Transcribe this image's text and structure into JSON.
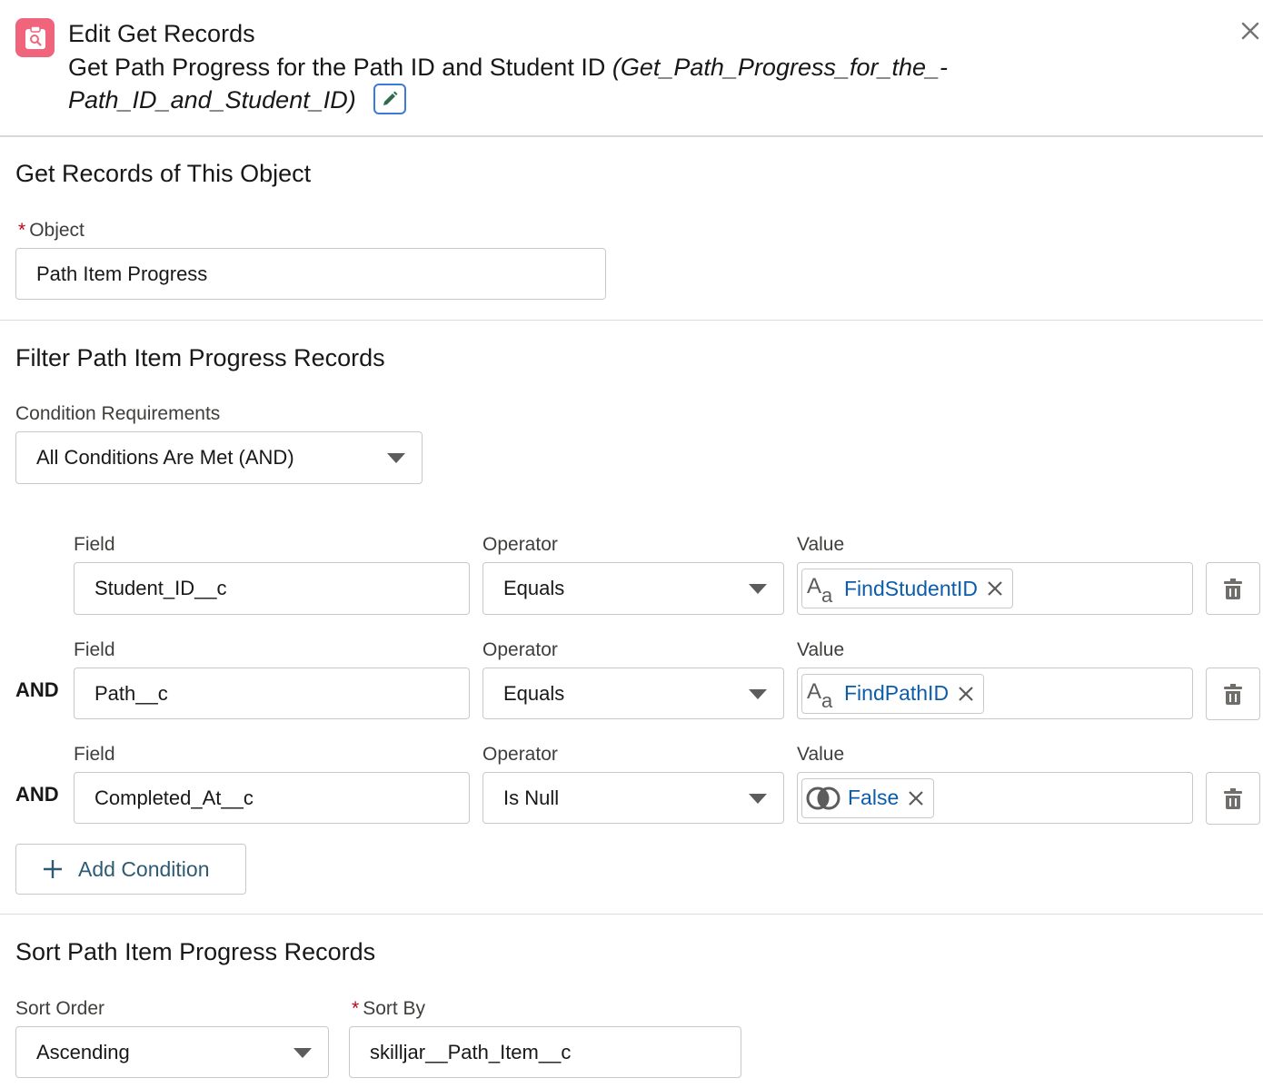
{
  "header": {
    "title": "Edit Get Records",
    "subtitle_text": "Get Path Progress for the Path ID and Student ID",
    "api_name": "(Get_Path_Progress_for_the_-Path_ID_and_Student_ID)",
    "icon": "get-records-icon",
    "icon_color": "#f0657c"
  },
  "object_section": {
    "title": "Get Records of This Object",
    "object_label": "Object",
    "object_value": "Path Item Progress"
  },
  "filter_section": {
    "title": "Filter Path Item Progress Records",
    "condition_requirements_label": "Condition Requirements",
    "condition_requirements_value": "All Conditions Are Met (AND)",
    "conditions": [
      {
        "connector": "",
        "field_label": "Field",
        "field": "Student_ID__c",
        "operator_label": "Operator",
        "operator": "Equals",
        "value_label": "Value",
        "value": "FindStudentID",
        "value_icon": "text-variable-icon"
      },
      {
        "connector": "AND",
        "field_label": "Field",
        "field": "Path__c",
        "operator_label": "Operator",
        "operator": "Equals",
        "value_label": "Value",
        "value": "FindPathID",
        "value_icon": "text-variable-icon"
      },
      {
        "connector": "AND",
        "field_label": "Field",
        "field": "Completed_At__c",
        "operator_label": "Operator",
        "operator": "Is Null",
        "value_label": "Value",
        "value": "False",
        "value_icon": "boolean-icon"
      }
    ],
    "add_condition_label": "Add Condition"
  },
  "sort_section": {
    "title": "Sort Path Item Progress Records",
    "sort_order_label": "Sort Order",
    "sort_order_value": "Ascending",
    "sort_by_label": "Sort By",
    "sort_by_value": "skilljar__Path_Item__c"
  },
  "colors": {
    "accent_blue": "#0b5cab",
    "required_red": "#ba0517",
    "button_text": "#2e5a74"
  }
}
